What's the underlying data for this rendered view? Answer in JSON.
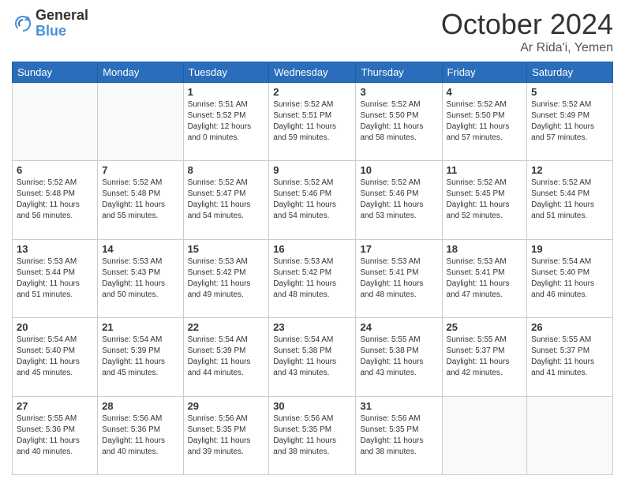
{
  "header": {
    "logo_general": "General",
    "logo_blue": "Blue",
    "month_title": "October 2024",
    "subtitle": "Ar Rida'i, Yemen"
  },
  "days_of_week": [
    "Sunday",
    "Monday",
    "Tuesday",
    "Wednesday",
    "Thursday",
    "Friday",
    "Saturday"
  ],
  "weeks": [
    [
      {
        "day": "",
        "info": ""
      },
      {
        "day": "",
        "info": ""
      },
      {
        "day": "1",
        "info": "Sunrise: 5:51 AM\nSunset: 5:52 PM\nDaylight: 12 hours\nand 0 minutes."
      },
      {
        "day": "2",
        "info": "Sunrise: 5:52 AM\nSunset: 5:51 PM\nDaylight: 11 hours\nand 59 minutes."
      },
      {
        "day": "3",
        "info": "Sunrise: 5:52 AM\nSunset: 5:50 PM\nDaylight: 11 hours\nand 58 minutes."
      },
      {
        "day": "4",
        "info": "Sunrise: 5:52 AM\nSunset: 5:50 PM\nDaylight: 11 hours\nand 57 minutes."
      },
      {
        "day": "5",
        "info": "Sunrise: 5:52 AM\nSunset: 5:49 PM\nDaylight: 11 hours\nand 57 minutes."
      }
    ],
    [
      {
        "day": "6",
        "info": "Sunrise: 5:52 AM\nSunset: 5:48 PM\nDaylight: 11 hours\nand 56 minutes."
      },
      {
        "day": "7",
        "info": "Sunrise: 5:52 AM\nSunset: 5:48 PM\nDaylight: 11 hours\nand 55 minutes."
      },
      {
        "day": "8",
        "info": "Sunrise: 5:52 AM\nSunset: 5:47 PM\nDaylight: 11 hours\nand 54 minutes."
      },
      {
        "day": "9",
        "info": "Sunrise: 5:52 AM\nSunset: 5:46 PM\nDaylight: 11 hours\nand 54 minutes."
      },
      {
        "day": "10",
        "info": "Sunrise: 5:52 AM\nSunset: 5:46 PM\nDaylight: 11 hours\nand 53 minutes."
      },
      {
        "day": "11",
        "info": "Sunrise: 5:52 AM\nSunset: 5:45 PM\nDaylight: 11 hours\nand 52 minutes."
      },
      {
        "day": "12",
        "info": "Sunrise: 5:52 AM\nSunset: 5:44 PM\nDaylight: 11 hours\nand 51 minutes."
      }
    ],
    [
      {
        "day": "13",
        "info": "Sunrise: 5:53 AM\nSunset: 5:44 PM\nDaylight: 11 hours\nand 51 minutes."
      },
      {
        "day": "14",
        "info": "Sunrise: 5:53 AM\nSunset: 5:43 PM\nDaylight: 11 hours\nand 50 minutes."
      },
      {
        "day": "15",
        "info": "Sunrise: 5:53 AM\nSunset: 5:42 PM\nDaylight: 11 hours\nand 49 minutes."
      },
      {
        "day": "16",
        "info": "Sunrise: 5:53 AM\nSunset: 5:42 PM\nDaylight: 11 hours\nand 48 minutes."
      },
      {
        "day": "17",
        "info": "Sunrise: 5:53 AM\nSunset: 5:41 PM\nDaylight: 11 hours\nand 48 minutes."
      },
      {
        "day": "18",
        "info": "Sunrise: 5:53 AM\nSunset: 5:41 PM\nDaylight: 11 hours\nand 47 minutes."
      },
      {
        "day": "19",
        "info": "Sunrise: 5:54 AM\nSunset: 5:40 PM\nDaylight: 11 hours\nand 46 minutes."
      }
    ],
    [
      {
        "day": "20",
        "info": "Sunrise: 5:54 AM\nSunset: 5:40 PM\nDaylight: 11 hours\nand 45 minutes."
      },
      {
        "day": "21",
        "info": "Sunrise: 5:54 AM\nSunset: 5:39 PM\nDaylight: 11 hours\nand 45 minutes."
      },
      {
        "day": "22",
        "info": "Sunrise: 5:54 AM\nSunset: 5:39 PM\nDaylight: 11 hours\nand 44 minutes."
      },
      {
        "day": "23",
        "info": "Sunrise: 5:54 AM\nSunset: 5:38 PM\nDaylight: 11 hours\nand 43 minutes."
      },
      {
        "day": "24",
        "info": "Sunrise: 5:55 AM\nSunset: 5:38 PM\nDaylight: 11 hours\nand 43 minutes."
      },
      {
        "day": "25",
        "info": "Sunrise: 5:55 AM\nSunset: 5:37 PM\nDaylight: 11 hours\nand 42 minutes."
      },
      {
        "day": "26",
        "info": "Sunrise: 5:55 AM\nSunset: 5:37 PM\nDaylight: 11 hours\nand 41 minutes."
      }
    ],
    [
      {
        "day": "27",
        "info": "Sunrise: 5:55 AM\nSunset: 5:36 PM\nDaylight: 11 hours\nand 40 minutes."
      },
      {
        "day": "28",
        "info": "Sunrise: 5:56 AM\nSunset: 5:36 PM\nDaylight: 11 hours\nand 40 minutes."
      },
      {
        "day": "29",
        "info": "Sunrise: 5:56 AM\nSunset: 5:35 PM\nDaylight: 11 hours\nand 39 minutes."
      },
      {
        "day": "30",
        "info": "Sunrise: 5:56 AM\nSunset: 5:35 PM\nDaylight: 11 hours\nand 38 minutes."
      },
      {
        "day": "31",
        "info": "Sunrise: 5:56 AM\nSunset: 5:35 PM\nDaylight: 11 hours\nand 38 minutes."
      },
      {
        "day": "",
        "info": ""
      },
      {
        "day": "",
        "info": ""
      }
    ]
  ]
}
